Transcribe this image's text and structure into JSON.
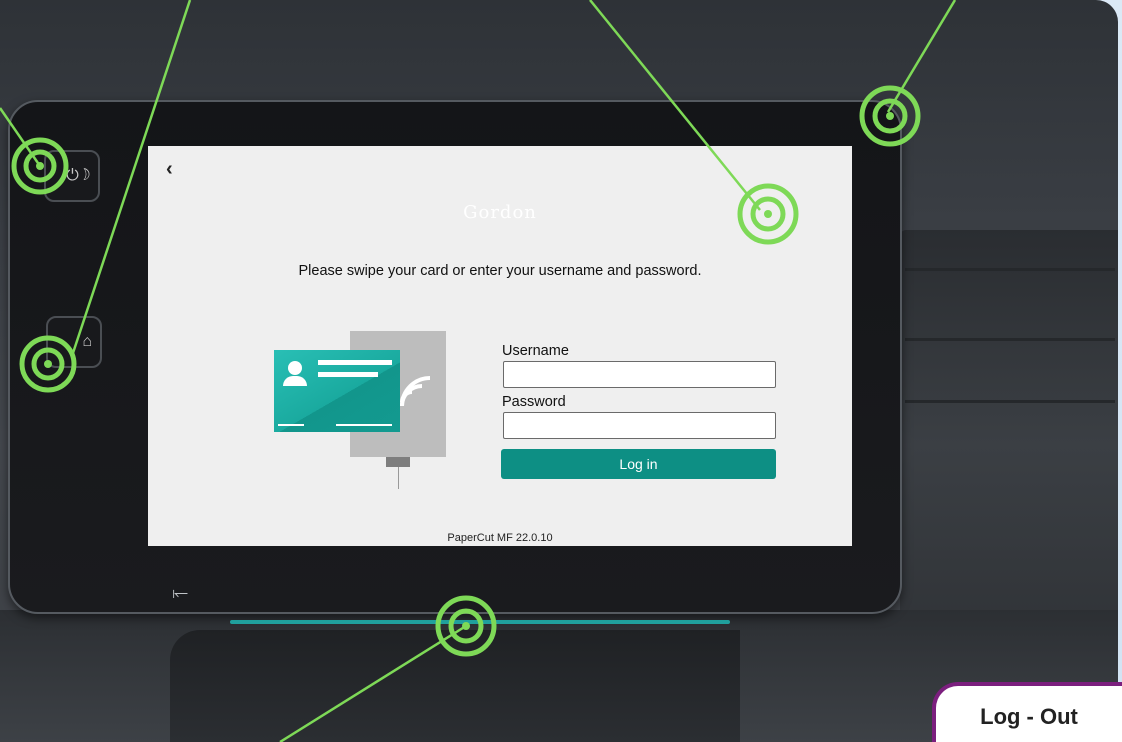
{
  "screen": {
    "back_icon": "chevron-left-icon",
    "brand": "Gordon",
    "prompt": "Please swipe your card or enter your username and password.",
    "username_label": "Username",
    "username_value": "",
    "password_label": "Password",
    "password_value": "",
    "login_label": "Log in",
    "version": "PaperCut MF 22.0.10"
  },
  "hardware": {
    "power_icon": "power-sleep-icon",
    "home_icon": "home-icon",
    "nfc_icon": "nfc-icon"
  },
  "badge": {
    "label": "Log - Out"
  },
  "colors": {
    "accent_teal": "#0d8f84",
    "callout_green": "#7ed957",
    "badge_border": "#7b1f7e"
  }
}
